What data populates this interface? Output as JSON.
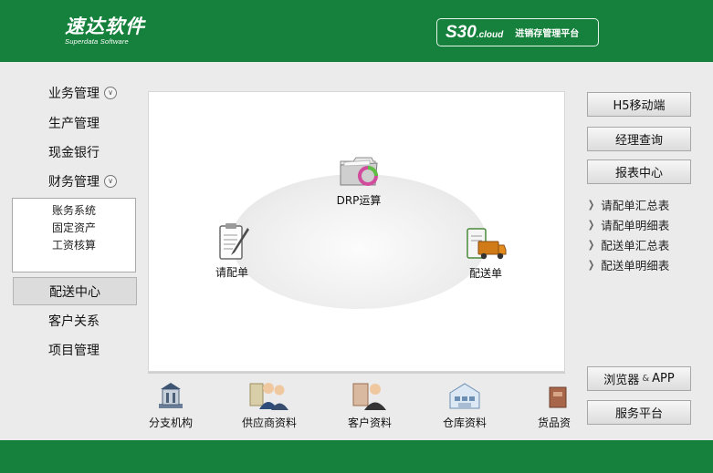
{
  "header": {
    "logo_text": "速达软件",
    "logo_subtitle": "Superdata Software",
    "product_name": "S30",
    "product_suffix": ".cloud",
    "product_title": "进销存管理平台",
    "bg_color": "#15813c"
  },
  "sidebar": {
    "items": [
      {
        "label": "业务管理",
        "icon": "expand-icon",
        "expandable": true
      },
      {
        "label": "生产管理"
      },
      {
        "label": "现金银行"
      },
      {
        "label": "财务管理",
        "icon": "expand-icon",
        "expandable": true
      },
      {
        "label": "配送中心",
        "active": true
      },
      {
        "label": "客户关系"
      },
      {
        "label": "项目管理"
      }
    ],
    "submenu": [
      "账务系统",
      "固定资产",
      "工资核算"
    ]
  },
  "diagram": {
    "drp": {
      "label": "DRP运算",
      "icon": "folder-refresh-icon"
    },
    "request": {
      "label": "请配单",
      "icon": "clipboard-pen-icon"
    },
    "delivery": {
      "label": "配送单",
      "icon": "delivery-truck-icon"
    }
  },
  "right": {
    "buttons": [
      "H5移动端",
      "经理查询",
      "报表中心"
    ],
    "reports": [
      "请配单汇总表",
      "请配单明细表",
      "配送单汇总表",
      "配送单明细表"
    ],
    "browser_label": "浏览器",
    "browser_amp": "&",
    "browser_app": "APP",
    "service_label": "服务平台"
  },
  "bottom": {
    "tiles": [
      {
        "label": "分支机构",
        "icon": "branch-building-icon"
      },
      {
        "label": "供应商资料",
        "icon": "supplier-people-icon"
      },
      {
        "label": "客户资料",
        "icon": "customer-person-icon"
      },
      {
        "label": "仓库资料",
        "icon": "warehouse-icon"
      },
      {
        "label": "货品资",
        "icon": "goods-icon"
      }
    ]
  }
}
